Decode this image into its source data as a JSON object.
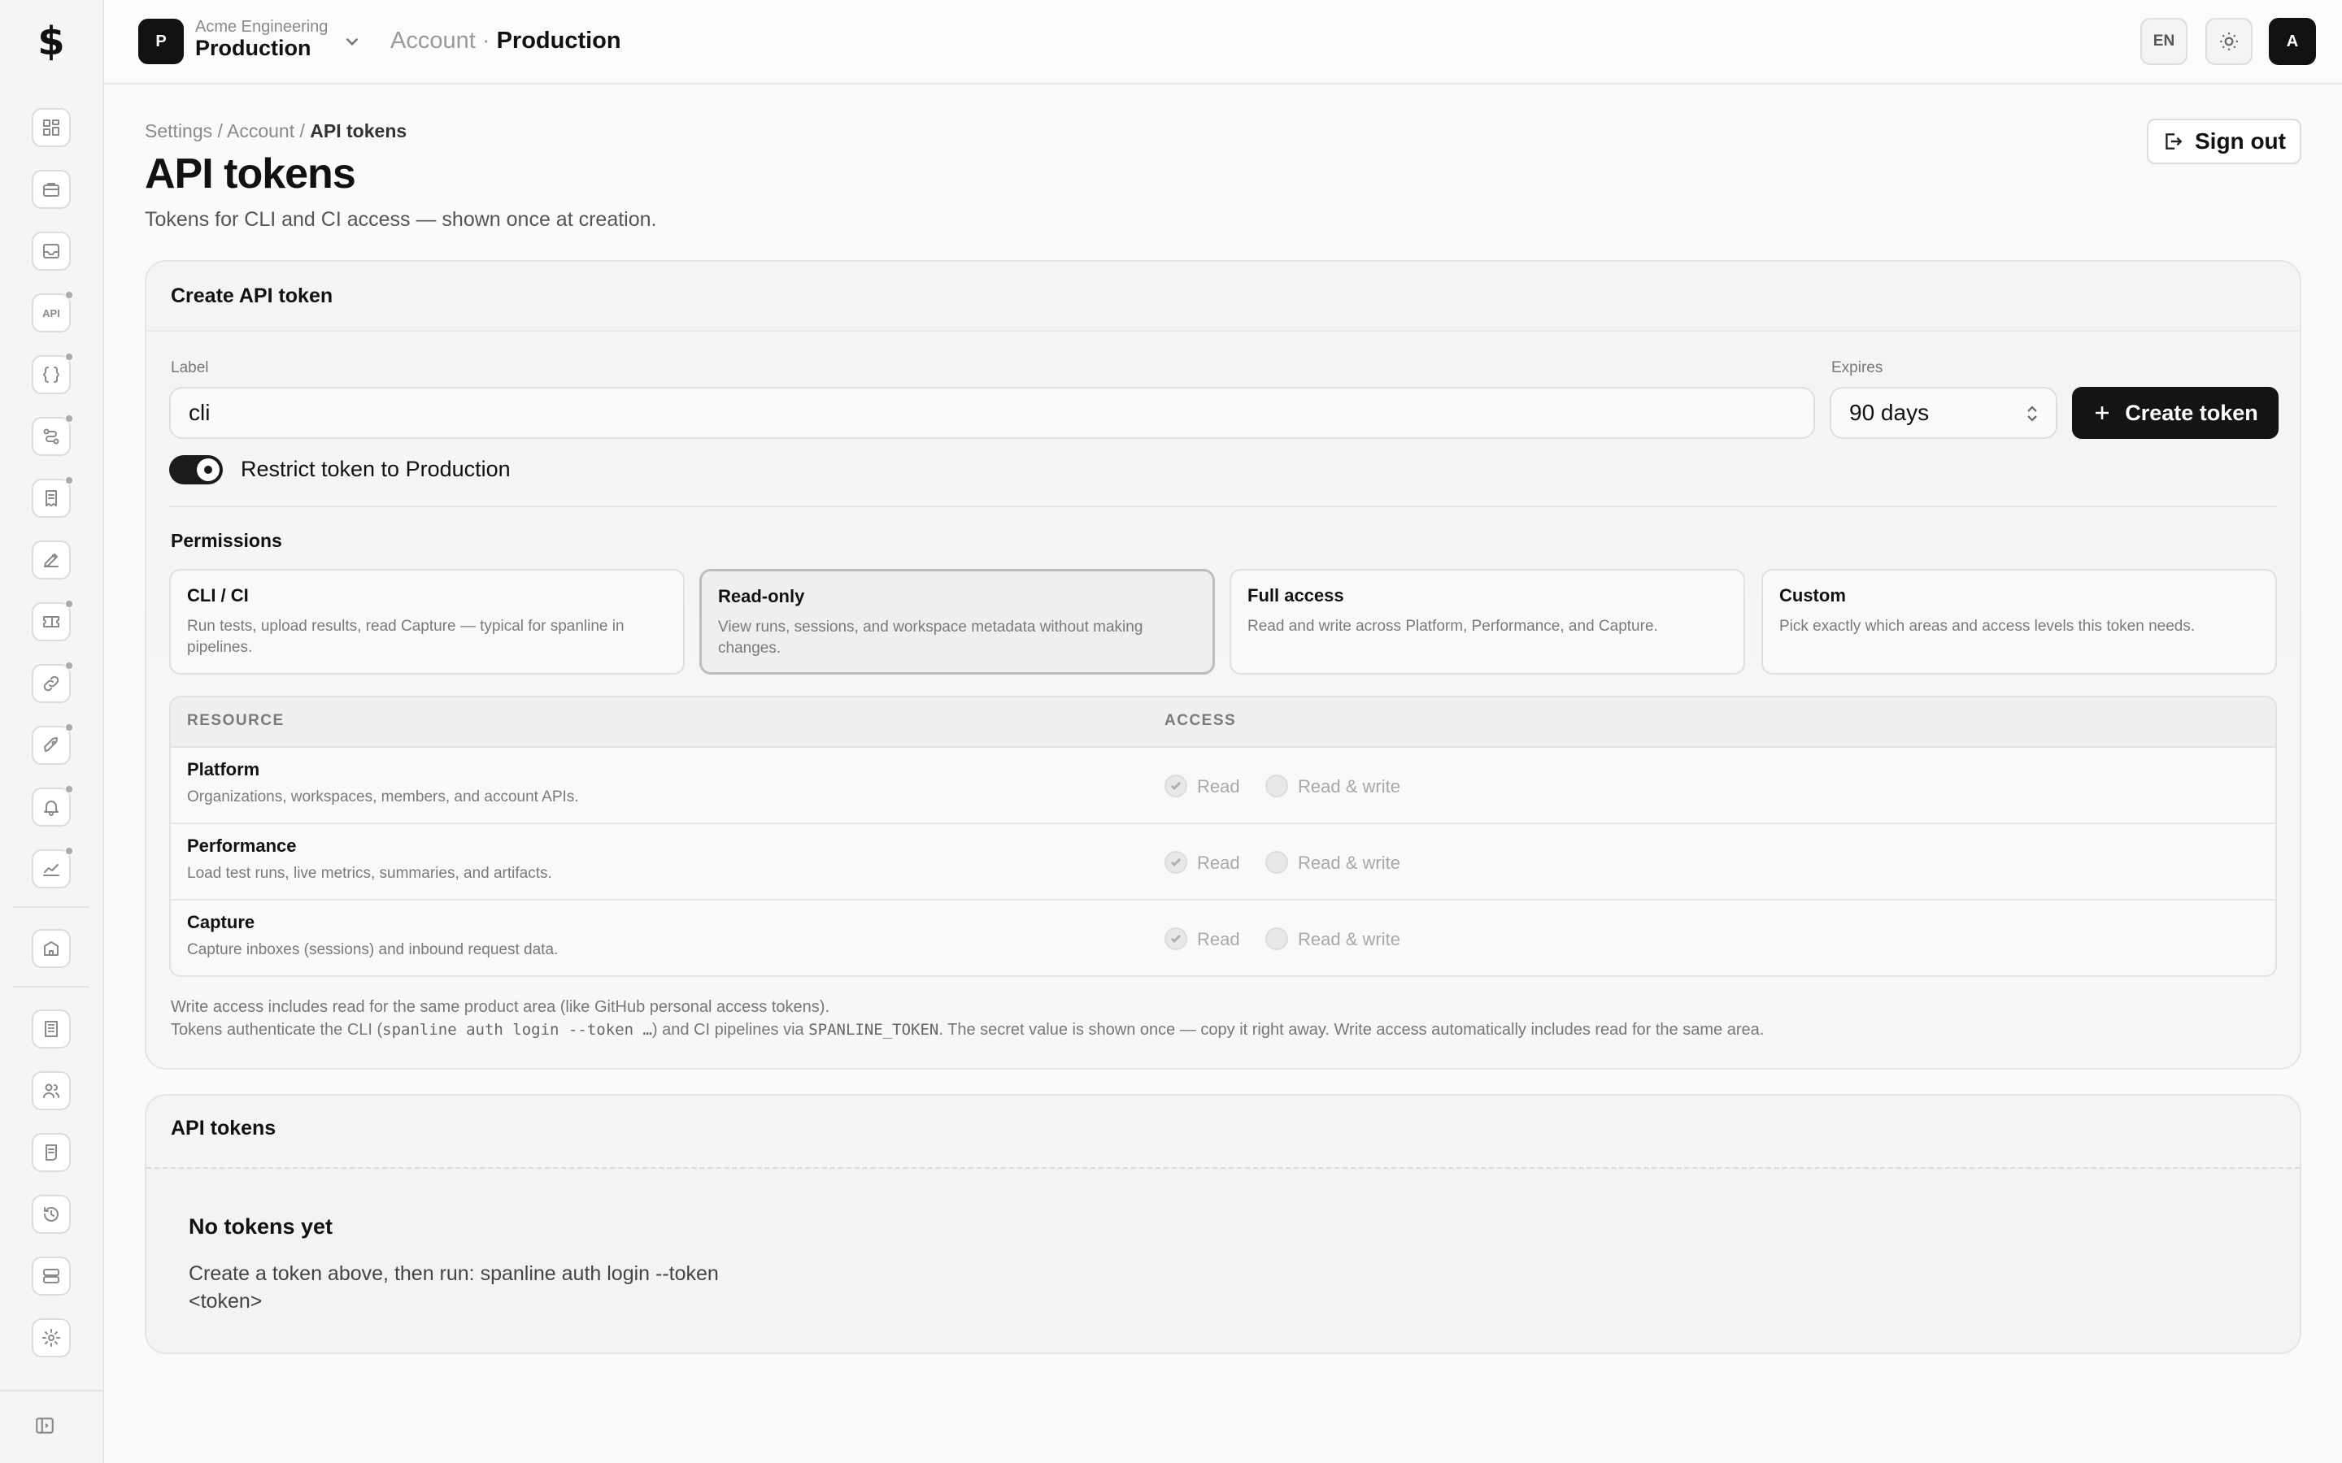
{
  "app": {
    "logo_glyph": "$"
  },
  "sidebar": {
    "icons": [
      {
        "name": "dashboard-icon"
      },
      {
        "name": "briefcase-icon"
      },
      {
        "name": "inbox-icon"
      },
      {
        "name": "api-icon",
        "label": "API"
      },
      {
        "name": "braces-icon"
      },
      {
        "name": "workflow-icon"
      },
      {
        "name": "report-icon"
      },
      {
        "name": "pen-icon"
      },
      {
        "name": "ticket-icon"
      },
      {
        "name": "link-icon"
      },
      {
        "name": "rocket-icon"
      },
      {
        "name": "bell-icon"
      },
      {
        "name": "chart-icon"
      },
      {
        "name": "building-icon"
      },
      {
        "name": "organization-icon"
      },
      {
        "name": "users-icon"
      },
      {
        "name": "receipt-icon"
      },
      {
        "name": "history-icon"
      },
      {
        "name": "storage-icon"
      },
      {
        "name": "gear-icon"
      }
    ]
  },
  "topbar": {
    "org_initial": "P",
    "org_name": "Acme Engineering",
    "env_name": "Production",
    "crumb_prefix": "Account ·",
    "crumb_current": "Production",
    "lang": "EN",
    "user_initial": "A"
  },
  "page": {
    "breadcrumb": {
      "part1": "Settings / Account / ",
      "current": "API tokens"
    },
    "title": "API tokens",
    "subtitle": "Tokens for CLI and CI access — shown once at creation.",
    "signout_label": "Sign out"
  },
  "create_card": {
    "title": "Create API token",
    "label_caption": "Label",
    "label_value": "cli",
    "expires_caption": "Expires",
    "expires_value": "90 days",
    "create_label": "Create token",
    "restrict_label": "Restrict token to Production",
    "restrict_on": true,
    "permissions_heading": "Permissions",
    "presets": [
      {
        "title": "CLI / CI",
        "desc": "Run tests, upload results, read Capture — typical for spanline in pipelines.",
        "active": false
      },
      {
        "title": "Read-only",
        "desc": "View runs, sessions, and workspace metadata without making changes.",
        "active": true
      },
      {
        "title": "Full access",
        "desc": "Read and write across Platform, Performance, and Capture.",
        "active": false
      },
      {
        "title": "Custom",
        "desc": "Pick exactly which areas and access levels this token needs.",
        "active": false
      }
    ],
    "table": {
      "col_resource": "RESOURCE",
      "col_access": "ACCESS",
      "read_label": "Read",
      "write_label": "Read & write",
      "rows": [
        {
          "name": "Platform",
          "desc": "Organizations, workspaces, members, and account APIs.",
          "access": "read"
        },
        {
          "name": "Performance",
          "desc": "Load test runs, live metrics, summaries, and artifacts.",
          "access": "read"
        },
        {
          "name": "Capture",
          "desc": "Capture inboxes (sessions) and inbound request data.",
          "access": "read"
        }
      ]
    },
    "footnote1": "Write access includes read for the same product area (like GitHub personal access tokens).",
    "footnote2_a": "Tokens authenticate the CLI (",
    "footnote2_code1": "spanline auth login --token …",
    "footnote2_b": ") and CI pipelines via ",
    "footnote2_code2": "SPANLINE_TOKEN",
    "footnote2_c": ". The secret value is shown once — copy it right away. Write access automatically includes read for the same area."
  },
  "tokens_card": {
    "title": "API tokens",
    "empty_title": "No tokens yet",
    "empty_desc": "Create a token above, then run: spanline auth login --token <token>"
  }
}
